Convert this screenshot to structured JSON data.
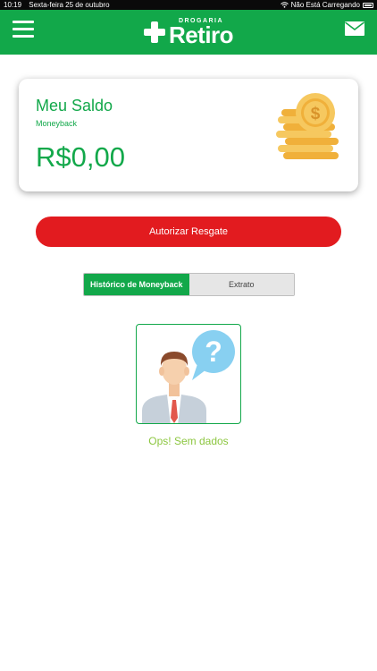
{
  "status_bar": {
    "time": "10:19",
    "date": "Sexta-feira 25 de outubro",
    "network": "Não Está Carregando"
  },
  "header": {
    "brand_top": "DROGARIA",
    "brand_name": "Retiro",
    "menu_icon": "hamburger-menu-icon",
    "mail_icon": "envelope-icon",
    "color": "#12a84a"
  },
  "balance_card": {
    "title": "Meu Saldo",
    "subtitle": "Moneyback",
    "amount": "R$0,00",
    "icon": "coins-stack-icon"
  },
  "redeem_button": {
    "label": "Autorizar Resgate",
    "color": "#e21b1f"
  },
  "tabs": [
    {
      "label": "Histórico de Moneyback",
      "active": true
    },
    {
      "label": "Extrato",
      "active": false
    }
  ],
  "empty_state": {
    "message": "Ops! Sem dados",
    "illustration": "person-question-icon",
    "color": "#8cc63f"
  }
}
